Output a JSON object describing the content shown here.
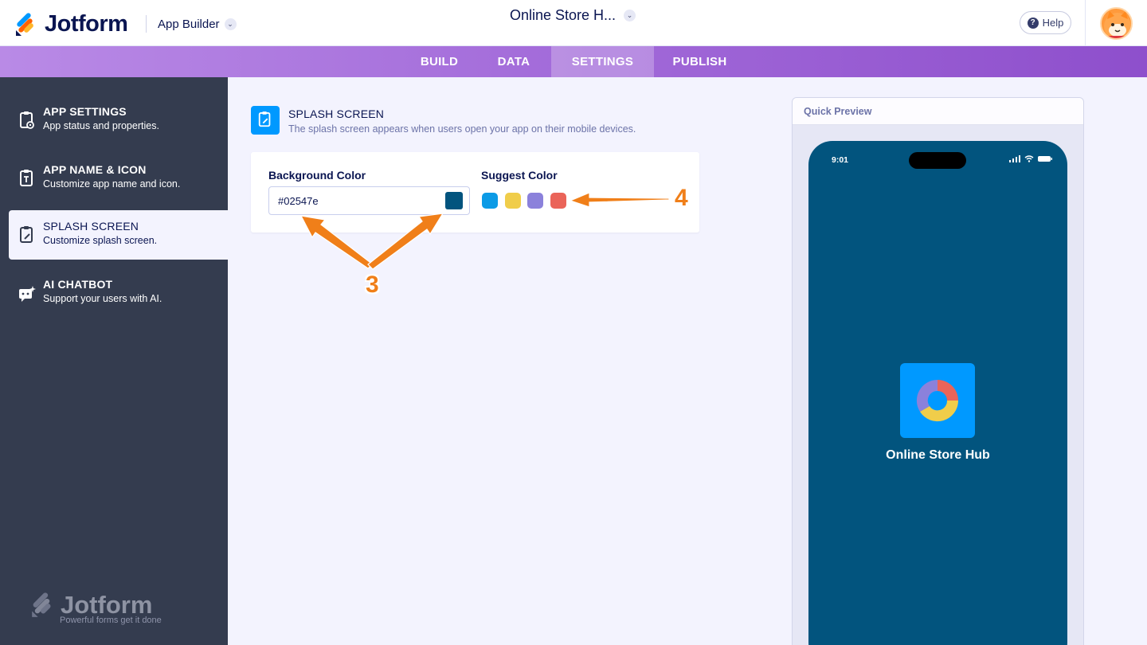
{
  "header": {
    "brand": "Jotform",
    "product": "App Builder",
    "app_title": "Online Store H...",
    "help_label": "Help"
  },
  "nav": {
    "tabs": [
      {
        "label": "BUILD"
      },
      {
        "label": "DATA"
      },
      {
        "label": "SETTINGS",
        "active": true
      },
      {
        "label": "PUBLISH"
      }
    ]
  },
  "sidebar": {
    "items": [
      {
        "title": "APP SETTINGS",
        "subtitle": "App status and properties.",
        "icon": "gear-document-icon"
      },
      {
        "title": "APP NAME & ICON",
        "subtitle": "Customize app name and icon.",
        "icon": "text-document-icon"
      },
      {
        "title": "SPLASH SCREEN",
        "subtitle": "Customize splash screen.",
        "icon": "edit-document-icon",
        "active": true
      },
      {
        "title": "AI CHATBOT",
        "subtitle": "Support your users with AI.",
        "icon": "chatbot-icon"
      }
    ],
    "footer_brand": "Jotform",
    "footer_tagline": "Powerful forms get it done"
  },
  "section": {
    "title": "SPLASH SCREEN",
    "description": "The splash screen appears when users open your app on their mobile devices."
  },
  "background_color": {
    "label": "Background Color",
    "value": "#02547e",
    "swatch": "#02547e"
  },
  "suggest_color": {
    "label": "Suggest Color",
    "colors": [
      "#0c9be6",
      "#f0cd4a",
      "#8b81db",
      "#ea6459"
    ]
  },
  "annotations": {
    "marker_3": "3",
    "marker_4": "4",
    "color": "#f07f19"
  },
  "preview": {
    "title": "Quick Preview",
    "time": "9:01",
    "app_name": "Online Store Hub",
    "background": "#02547e"
  },
  "colors": {
    "accent": "#0099ff",
    "nav_gradient_start": "#b98ae6",
    "nav_gradient_end": "#8e4fcc",
    "sidebar_bg": "#343c4f"
  }
}
